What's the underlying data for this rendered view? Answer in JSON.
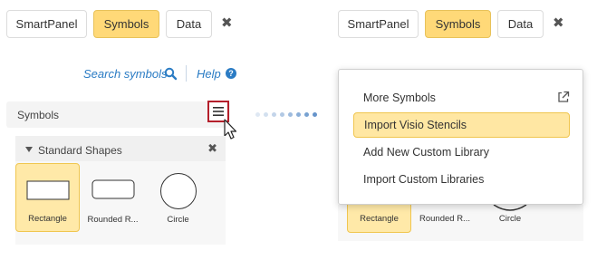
{
  "left_panel": {
    "tabs": [
      {
        "label": "SmartPanel",
        "active": false
      },
      {
        "label": "Symbols",
        "active": true
      },
      {
        "label": "Data",
        "active": false
      }
    ],
    "close_glyph": "✖",
    "search_link": "Search symbols",
    "help_link": "Help",
    "help_glyph": "?",
    "symbols_header": "Symbols",
    "library": {
      "title": "Standard Shapes",
      "close_glyph": "✖",
      "shapes": [
        {
          "label": "Rectangle",
          "icon": "rectangle-shape-icon",
          "selected": true
        },
        {
          "label": "Rounded R...",
          "icon": "rounded-rectangle-shape-icon",
          "selected": false
        },
        {
          "label": "Circle",
          "icon": "circle-shape-icon",
          "selected": false
        }
      ]
    }
  },
  "right_panel": {
    "tabs": [
      {
        "label": "SmartPanel",
        "active": false
      },
      {
        "label": "Symbols",
        "active": true
      },
      {
        "label": "Data",
        "active": false
      }
    ],
    "close_glyph": "✖",
    "dropdown_menu": [
      {
        "label": "More Symbols",
        "highlighted": false,
        "icon": "external-link-icon"
      },
      {
        "label": "Import Visio Stencils",
        "highlighted": true
      },
      {
        "label": "Add New Custom Library",
        "highlighted": false
      },
      {
        "label": "Import Custom Libraries",
        "highlighted": false
      }
    ],
    "shape_labels": [
      "Rectangle",
      "Rounded R...",
      "Circle"
    ]
  },
  "colors": {
    "accent_yellow": "#ffd978",
    "highlight_yellow": "#ffe7a3",
    "link_blue": "#2b7cc4",
    "menu_button_border": "#b41f2b"
  }
}
